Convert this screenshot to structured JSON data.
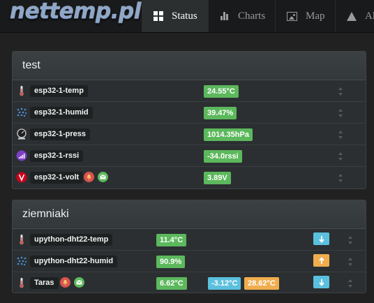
{
  "logo": "nettemp.pl",
  "nav": {
    "tabs": [
      {
        "label": "Status",
        "icon": "grid-icon"
      },
      {
        "label": "Charts",
        "icon": "bar-chart-icon"
      },
      {
        "label": "Map",
        "icon": "picture-icon"
      },
      {
        "label": "Al",
        "icon": "warning-icon"
      }
    ]
  },
  "groups": [
    {
      "title": "test",
      "rows": [
        {
          "name": "esp32-1-temp",
          "icon": "thermometer-icon",
          "value": "24.55°C"
        },
        {
          "name": "esp32-1-humid",
          "icon": "humidity-icon",
          "value": "39.47%"
        },
        {
          "name": "esp32-1-press",
          "icon": "gauge-icon",
          "value": "1014.35hPa"
        },
        {
          "name": "esp32-1-rssi",
          "icon": "signal-icon",
          "value": "-34.0rssi"
        },
        {
          "name": "esp32-1-volt",
          "icon": "voltage-icon",
          "value": "3.89V",
          "badges": [
            "bell-icon",
            "mail-icon"
          ]
        }
      ]
    },
    {
      "title": "ziemniaki",
      "rows": [
        {
          "name": "upython-dht22-temp",
          "icon": "thermometer-icon",
          "value": "11.4°C",
          "trend": "down"
        },
        {
          "name": "upython-dht22-humid",
          "icon": "humidity-icon",
          "value": "90.9%",
          "trend": "up"
        },
        {
          "name": "Taras",
          "icon": "thermometer-icon",
          "value": "6.62°C",
          "min": "-3.12°C",
          "max": "28.62°C",
          "trend": "down",
          "badges": [
            "bell-icon",
            "mail-icon"
          ]
        }
      ]
    }
  ],
  "colors": {
    "ok": "#5cb85c",
    "min": "#5bc0de",
    "max": "#f0ad4e"
  }
}
